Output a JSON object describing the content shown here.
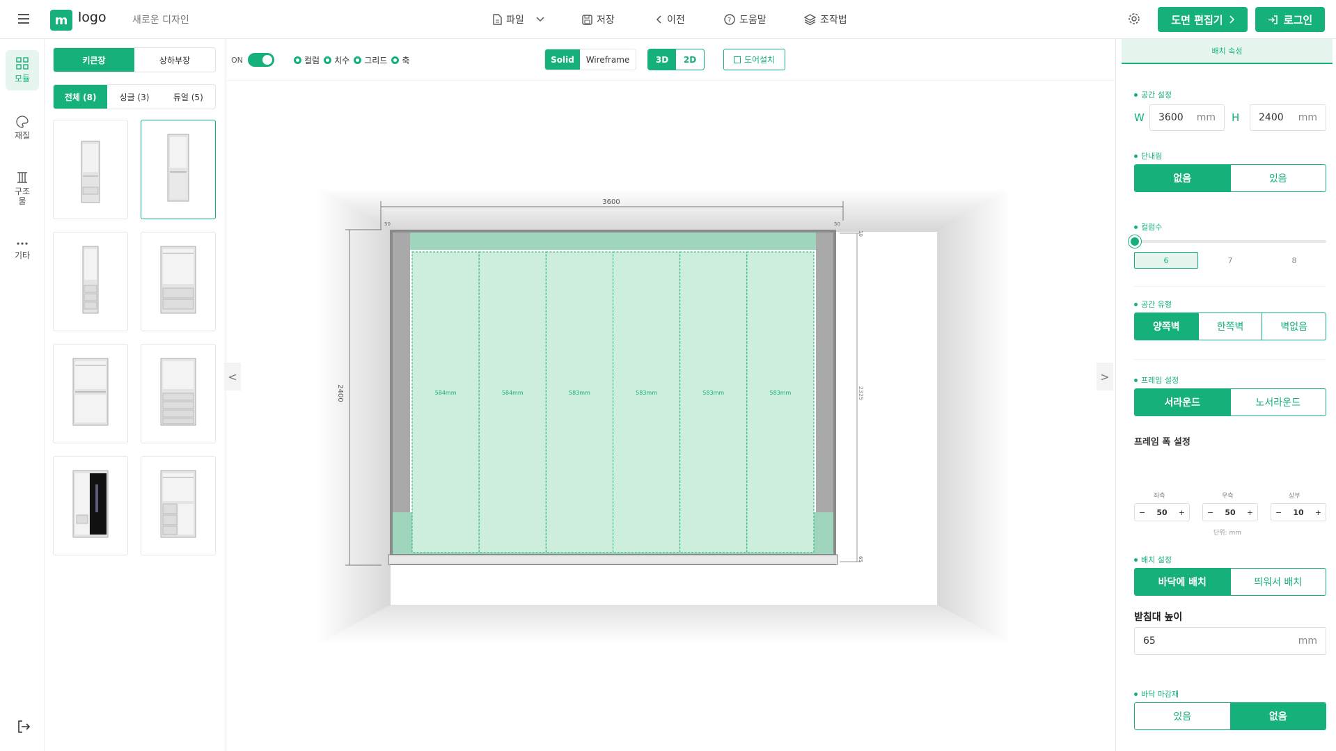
{
  "header": {
    "logo_letter": "m",
    "logo_text": "logo",
    "design_name": "새로운 디자인",
    "file_label": "파일",
    "save_label": "저장",
    "back_label": "이전",
    "help_label": "도움말",
    "controls_label": "조작법",
    "edit_plan_label": "도면 편집기",
    "login_label": "로그인"
  },
  "rail": {
    "module_label": "모듈",
    "material_label": "재질",
    "structure_label": "구조물",
    "etc_label": "기타"
  },
  "modules": {
    "tab_tall": "키큰장",
    "tab_upper_lower": "상하부장",
    "filter_all": "전체 (8)",
    "filter_single": "싱글 (3)",
    "filter_dual": "듀얼 (5)"
  },
  "viewbar": {
    "on_label": "ON",
    "radio_column": "컬럼",
    "radio_dimension": "치수",
    "radio_grid": "그리드",
    "radio_axis": "축",
    "mode_solid": "Solid",
    "mode_wireframe": "Wireframe",
    "view_3d": "3D",
    "view_2d": "2D",
    "door_install": "도어설치"
  },
  "canvas": {
    "dim_width": "3600",
    "dim_height": "2400",
    "dim_left_frame": "50",
    "dim_right_frame": "50",
    "dim_top": "10",
    "dim_inner_height": "2325",
    "dim_base": "65",
    "columns": [
      "584mm",
      "584mm",
      "583mm",
      "583mm",
      "583mm",
      "583mm"
    ],
    "collapse_left": "<",
    "collapse_right": ">"
  },
  "props": {
    "title": "배치 속성",
    "space_label": "공간 설정",
    "w_label": "W",
    "w_value": "3600",
    "h_label": "H",
    "h_value": "2400",
    "unit_mm": "mm",
    "step_label": "단내림",
    "step_none": "없음",
    "step_yes": "있음",
    "column_count_label": "컬럼수",
    "column_count_value": 6,
    "column_opt_6": "6",
    "column_opt_7": "7",
    "column_opt_8": "8",
    "space_type_label": "공간 유형",
    "space_both": "양쪽벽",
    "space_one": "한쪽벽",
    "space_none": "벽없음",
    "frame_label": "프레임 설정",
    "frame_surround": "서라운드",
    "frame_no_surround": "노서라운드",
    "frame_width_label": "프레임 폭 설정",
    "frame_left_label": "좌측",
    "frame_right_label": "우측",
    "frame_top_label": "상부",
    "frame_left_value": "50",
    "frame_right_value": "50",
    "frame_top_value": "10",
    "unit_note": "단위: mm",
    "placement_label": "배치 설정",
    "place_floor": "바닥에 배치",
    "place_float": "띄워서 배치",
    "base_height_label": "받침대 높이",
    "base_height_value": "65",
    "floor_finish_label": "바닥 마감재",
    "floor_yes": "있음",
    "floor_no": "없음"
  },
  "colors": {
    "accent": "#16b07a",
    "accent_light": "#e6f6ef",
    "column_fill": "#cdeedd"
  }
}
